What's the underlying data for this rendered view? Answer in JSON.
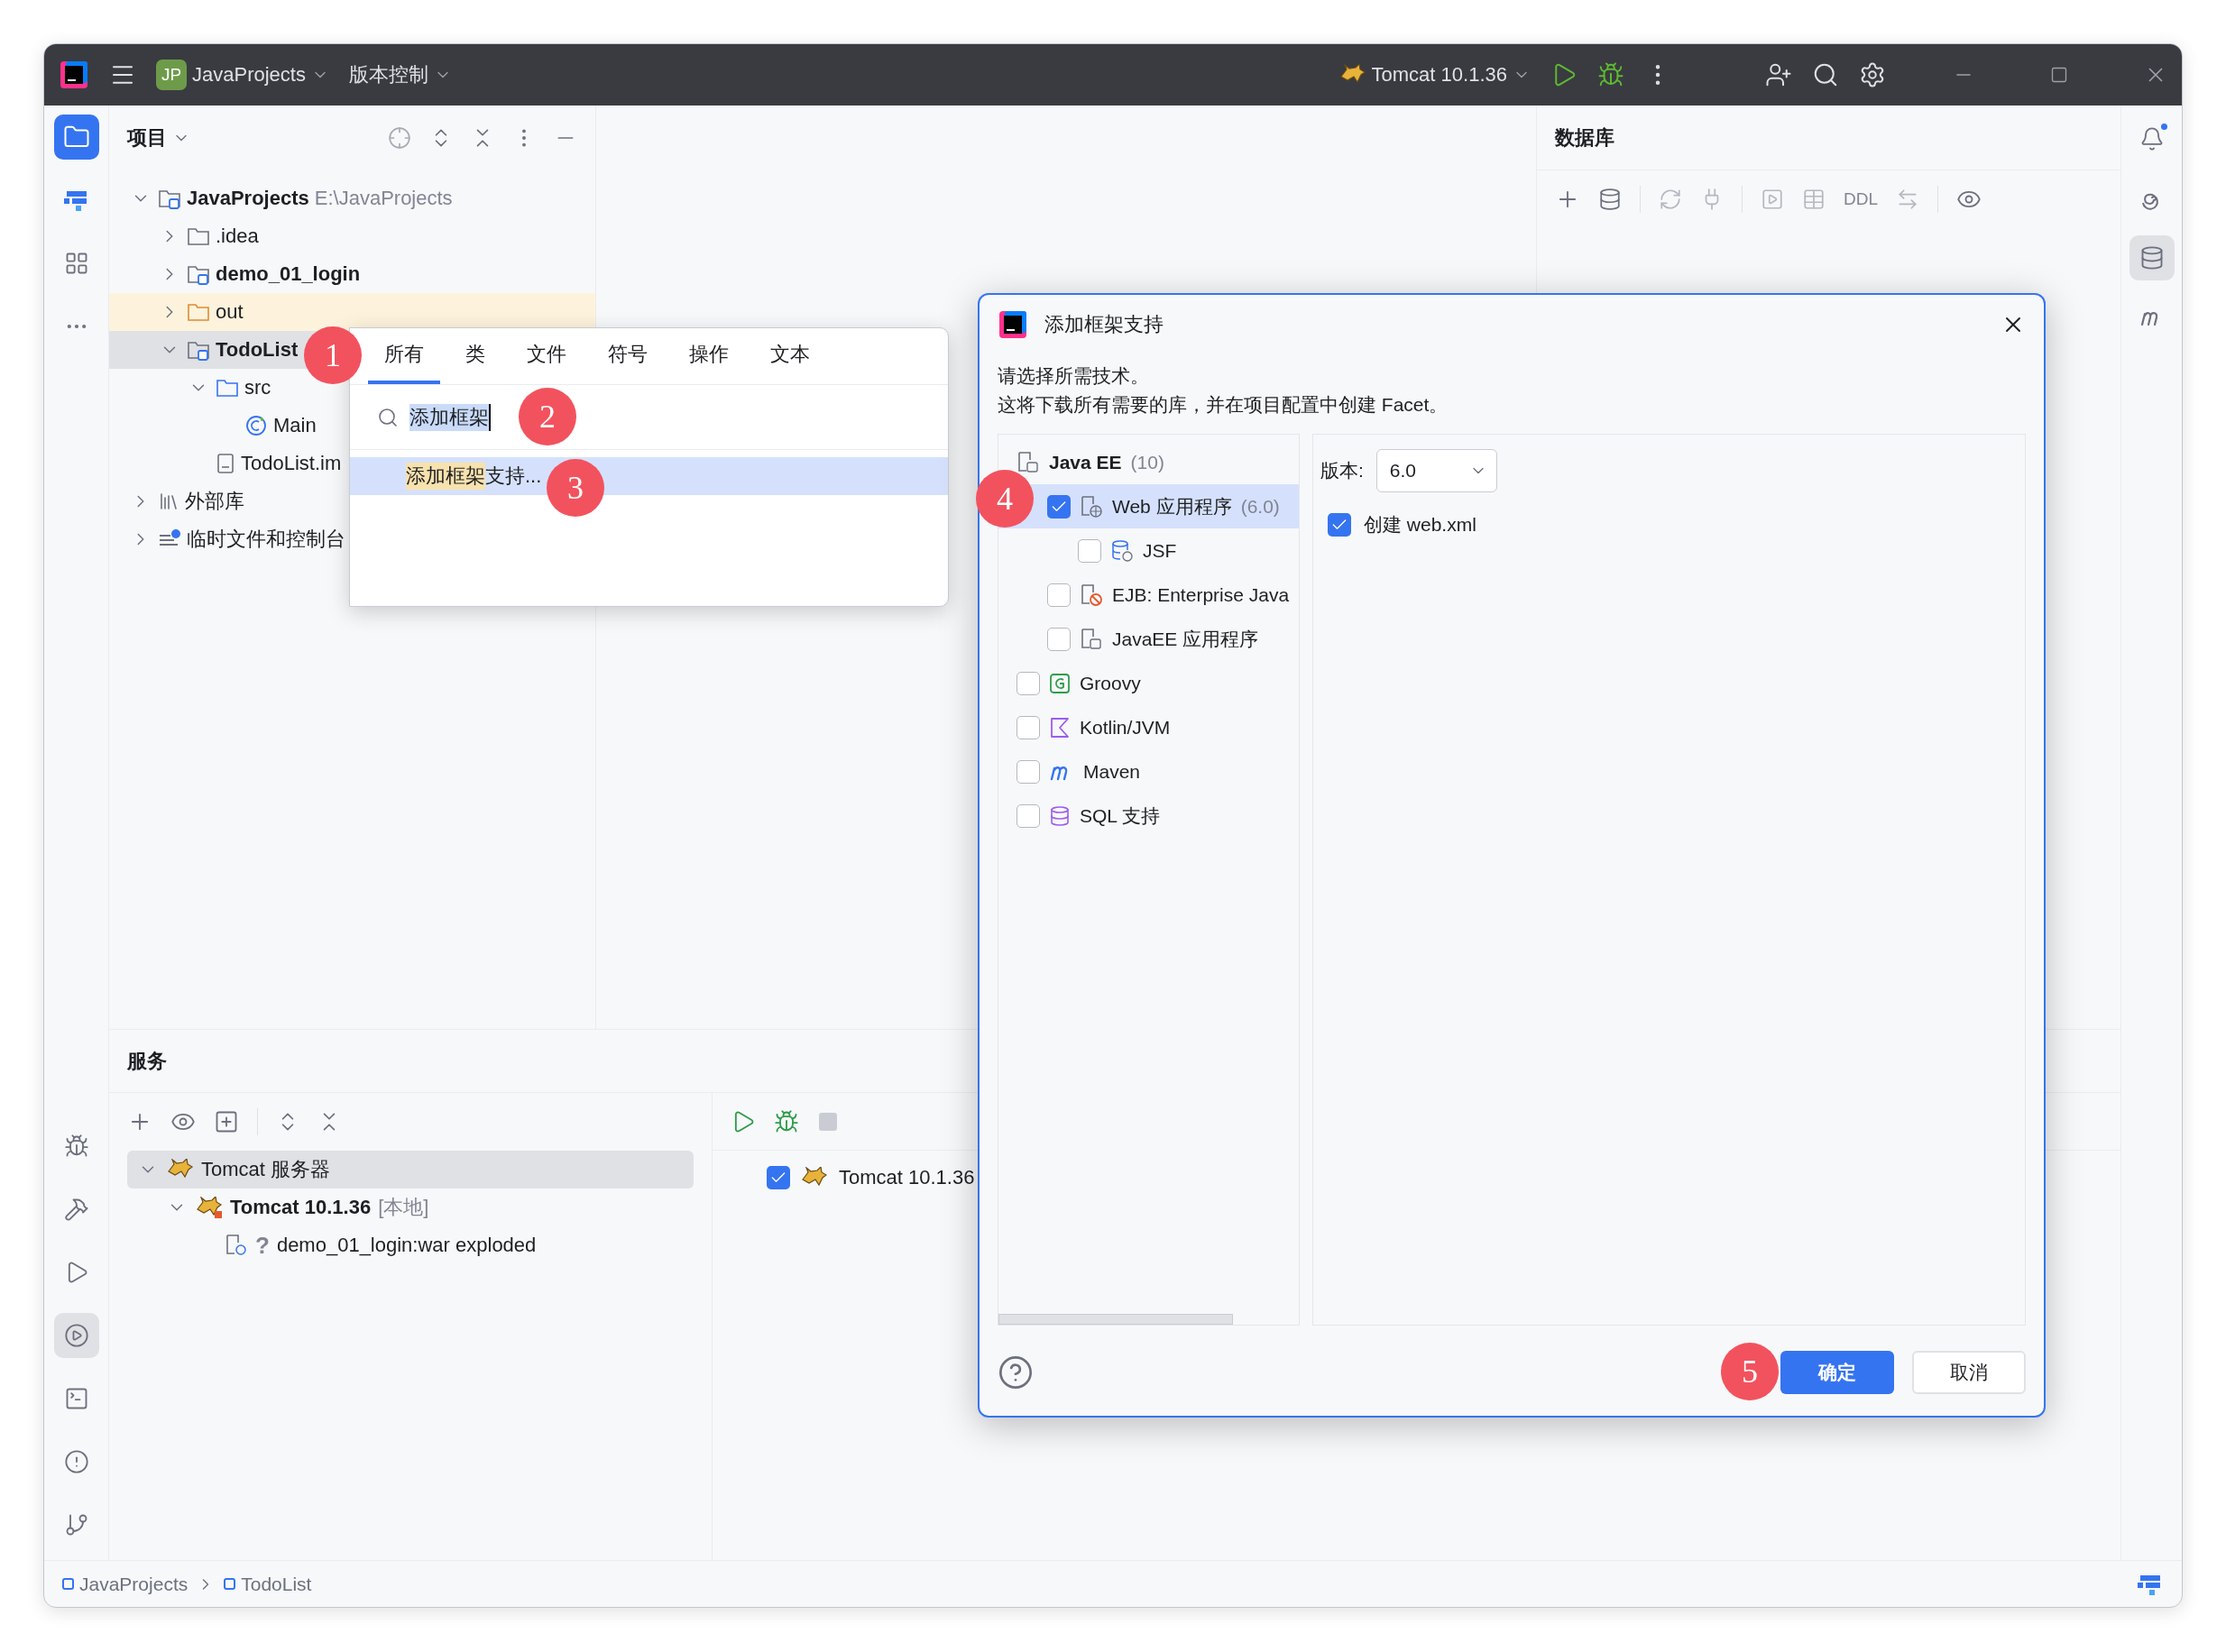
{
  "title_bar": {
    "project_badge": "JP",
    "project": "JavaProjects",
    "vcs": "版本控制",
    "run_config": "Tomcat 10.1.36"
  },
  "left_tools": [
    {
      "kind": "folder",
      "selected": true
    },
    {
      "kind": "bars",
      "selected": false
    },
    {
      "kind": "grid",
      "selected": false
    },
    {
      "kind": "more",
      "selected": false
    }
  ],
  "left_tools_bottom": [
    {
      "kind": "bug",
      "selected": false
    },
    {
      "kind": "hammer",
      "selected": false
    },
    {
      "kind": "run",
      "selected": false
    },
    {
      "kind": "services",
      "selected": true
    },
    {
      "kind": "terminal",
      "selected": false
    },
    {
      "kind": "problems",
      "selected": false
    },
    {
      "kind": "git",
      "selected": false
    }
  ],
  "project_panel": {
    "title": "项目",
    "tree": [
      {
        "label": "JavaProjects",
        "hint": "E:\\JavaProjects",
        "kind": "module",
        "expanded": true,
        "selected": false,
        "children": [
          {
            "label": ".idea",
            "kind": "folder",
            "expanded": false,
            "selected": false
          },
          {
            "label": "demo_01_login",
            "kind": "module",
            "expanded": false,
            "selected": false
          },
          {
            "label": "out",
            "kind": "excluded",
            "expanded": false,
            "selected": false
          },
          {
            "label": "TodoList",
            "kind": "module",
            "expanded": true,
            "selected": true,
            "children": [
              {
                "label": "src",
                "kind": "source",
                "expanded": true,
                "selected": false,
                "children": [
                  {
                    "label": "Main",
                    "kind": "class",
                    "selected": false
                  }
                ]
              },
              {
                "label": "TodoList.im",
                "kind": "file",
                "selected": false
              }
            ]
          }
        ]
      },
      {
        "label": "外部库",
        "kind": "library",
        "expanded": false,
        "selected": false
      },
      {
        "label": "临时文件和控制台",
        "kind": "scratch",
        "expanded": false,
        "selected": false
      }
    ]
  },
  "popup": {
    "tabs": [
      {
        "label": "所有",
        "selected": true
      },
      {
        "label": "类",
        "selected": false
      },
      {
        "label": "文件",
        "selected": false
      },
      {
        "label": "符号",
        "selected": false
      },
      {
        "label": "操作",
        "selected": false
      },
      {
        "label": "文本",
        "selected": false
      }
    ],
    "query": "添加框架",
    "results": [
      {
        "parts": [
          {
            "text": "添加框架",
            "match": true
          },
          {
            "text": "支持...",
            "match": false
          }
        ],
        "selected": true
      }
    ]
  },
  "database_panel": {
    "title": "数据库",
    "ddl": "DDL"
  },
  "right_tools": [
    {
      "kind": "bell",
      "selected": false,
      "notification": true
    },
    {
      "kind": "spiral",
      "selected": false,
      "notification": false
    },
    {
      "kind": "database",
      "selected": true,
      "notification": false
    },
    {
      "kind": "maven",
      "selected": false,
      "notification": false
    }
  ],
  "services": {
    "title": "服务",
    "tree": [
      {
        "label": "Tomcat 服务器",
        "kind": "group",
        "expanded": true,
        "selected": true,
        "children": [
          {
            "label": "Tomcat 10.1.36",
            "hint": "[本地]",
            "kind": "server",
            "expanded": true,
            "selected": false,
            "children": [
              {
                "label": "demo_01_login:war exploded",
                "status": "?",
                "kind": "artifact",
                "selected": false
              }
            ]
          }
        ]
      }
    ],
    "detail": {
      "label": "Tomcat 10.1.36",
      "checked": true
    }
  },
  "status_bar": {
    "breadcrumbs": [
      "JavaProjects",
      "TodoList"
    ]
  },
  "dialog": {
    "title": "添加框架支持",
    "description": [
      "请选择所需技术。",
      "这将下载所有需要的库，并在项目配置中创建 Facet。"
    ],
    "frameworks": [
      {
        "label": "Java EE",
        "hint": "(10)",
        "kind": "javaee",
        "selected": false,
        "children": [
          {
            "label": "Web 应用程序",
            "hint": "(6.0)",
            "kind": "web",
            "checked": true,
            "selected": true,
            "children": [
              {
                "label": "JSF",
                "kind": "jsf",
                "checked": false,
                "selected": false
              }
            ]
          },
          {
            "label": "EJB: Enterprise Java",
            "kind": "ejb",
            "checked": false,
            "selected": false
          },
          {
            "label": "JavaEE 应用程序",
            "kind": "javaee",
            "checked": false,
            "selected": false
          }
        ]
      },
      {
        "label": "Groovy",
        "kind": "groovy",
        "checked": false,
        "selected": false
      },
      {
        "label": "Kotlin/JVM",
        "kind": "kotlin",
        "checked": false,
        "selected": false
      },
      {
        "label": "Maven",
        "kind": "maven",
        "checked": false,
        "selected": false
      },
      {
        "label": "SQL 支持",
        "kind": "sql",
        "checked": false,
        "selected": false
      }
    ],
    "version_label": "版本:",
    "version": "6.0",
    "create_xml": {
      "label": "创建 web.xml",
      "checked": true
    },
    "buttons": [
      {
        "label": "确定",
        "kind": "primary"
      },
      {
        "label": "取消",
        "kind": "secondary"
      }
    ]
  },
  "annotations": [
    "1",
    "2",
    "3",
    "4",
    "5"
  ]
}
